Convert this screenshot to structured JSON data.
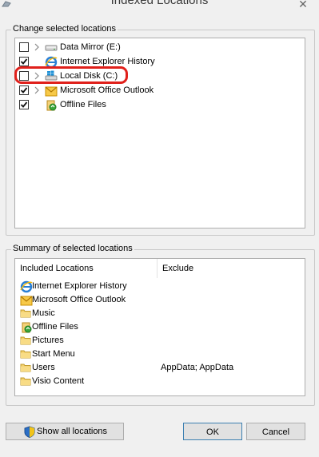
{
  "window": {
    "title": "Indexed Locations",
    "close_glyph": "✕"
  },
  "change_group": {
    "legend": "Change selected locations",
    "items": [
      {
        "label": "Data Mirror (E:)",
        "checked": false,
        "expandable": true,
        "icon": "drive-icon"
      },
      {
        "label": "Internet Explorer History",
        "checked": true,
        "expandable": false,
        "icon": "internet-explorer-icon"
      },
      {
        "label": "Local Disk (C:)",
        "checked": false,
        "expandable": true,
        "icon": "windows-drive-icon",
        "highlighted": true,
        "highlight_color": "#e0201b"
      },
      {
        "label": "Microsoft Office Outlook",
        "checked": true,
        "expandable": true,
        "icon": "outlook-icon"
      },
      {
        "label": "Offline Files",
        "checked": true,
        "expandable": false,
        "icon": "offline-files-icon"
      }
    ]
  },
  "summary_group": {
    "legend": "Summary of selected locations",
    "columns": {
      "included": "Included Locations",
      "exclude": "Exclude"
    },
    "rows": [
      {
        "location": "Internet Explorer History",
        "exclude": "",
        "icon": "internet-explorer-icon"
      },
      {
        "location": "Microsoft Office Outlook",
        "exclude": "",
        "icon": "outlook-icon"
      },
      {
        "location": "Music",
        "exclude": "",
        "icon": "folder-icon"
      },
      {
        "location": "Offline Files",
        "exclude": "",
        "icon": "offline-files-icon"
      },
      {
        "location": "Pictures",
        "exclude": "",
        "icon": "folder-icon"
      },
      {
        "location": "Start Menu",
        "exclude": "",
        "icon": "folder-icon"
      },
      {
        "location": "Users",
        "exclude": "AppData; AppData",
        "icon": "folder-icon"
      },
      {
        "location": "Visio Content",
        "exclude": "",
        "icon": "folder-icon"
      }
    ]
  },
  "buttons": {
    "show_all": "Show all locations",
    "ok": "OK",
    "cancel": "Cancel"
  },
  "colors": {
    "highlight": "#e0201b",
    "ok_border": "#3c7fb1"
  }
}
